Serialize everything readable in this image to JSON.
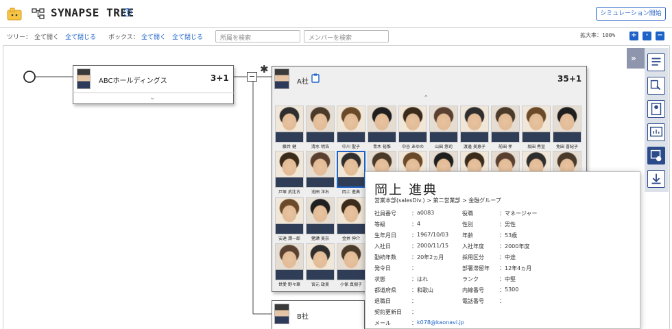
{
  "header": {
    "title": "SYNAPSE TREE",
    "help": "?",
    "simulation_button": "シミュレーション開始"
  },
  "toolbar": {
    "tree_label": "ツリー：",
    "tree_expand": "全て開く",
    "tree_collapse": "全て閉じる",
    "box_label": "ボックス：",
    "box_expand": "全て開く",
    "box_collapse": "全て閉じる",
    "search_dept_placeholder": "所属を検索",
    "search_member_placeholder": "メンバーを検索",
    "zoom_label": "拡大率：100%",
    "zoom_in": "+",
    "zoom_reset": "·",
    "zoom_out": "−"
  },
  "tree": {
    "root": {
      "name": "ABCホールディングス",
      "count": "3+1"
    },
    "company_a": {
      "name": "A社",
      "count": "35+1",
      "marker": "✱",
      "collapse": "−"
    },
    "company_b": {
      "name": "B社"
    }
  },
  "members": [
    "藤井 健",
    "清水 明浩",
    "中川 聖子",
    "青木 裕惟",
    "中谷 あゆの",
    "山田 悠司",
    "渡邊 美恵子",
    "前田 孝",
    "坂田 秀宣",
    "免田 喜紀子",
    "戸塚 武比古",
    "池田 洋右",
    "岡上 進典",
    "",
    "",
    "",
    "",
    "",
    "",
    "",
    "安達 潤一郎",
    "猪瀬 美奈",
    "金井 伸介",
    "世愛 野々華",
    "宮元 政美",
    "小保 真樹子"
  ],
  "selected_member": "岡上 進典",
  "popup": {
    "name": "岡上 進典",
    "path": "営業本部(salesDiv.) > 第二営業部 > 金融グループ",
    "left": [
      {
        "label": "社員番号",
        "value": "a0083"
      },
      {
        "label": "等級",
        "value": "4"
      },
      {
        "label": "生年月日",
        "value": "1967/10/03"
      },
      {
        "label": "入社日",
        "value": "2000/11/15"
      },
      {
        "label": "勤続年数",
        "value": "20年2ヵ月"
      },
      {
        "label": "発令日",
        "value": ""
      },
      {
        "label": "状態",
        "value": "はれ"
      },
      {
        "label": "都道府県",
        "value": "和歌山"
      },
      {
        "label": "退職日",
        "value": ""
      },
      {
        "label": "契約更新日",
        "value": ""
      },
      {
        "label": "メール",
        "value": "k078@kaonavi.jp"
      }
    ],
    "right": [
      {
        "label": "役職",
        "value": "マネージャー"
      },
      {
        "label": "性別",
        "value": "男性"
      },
      {
        "label": "年齢",
        "value": "53歳"
      },
      {
        "label": "入社年度",
        "value": "2000年度"
      },
      {
        "label": "採用区分",
        "value": "中途"
      },
      {
        "label": "部署滞留年",
        "value": "12年4ヵ月"
      },
      {
        "label": "ランク",
        "value": "中堅"
      },
      {
        "label": "内線番号",
        "value": "5300"
      },
      {
        "label": "電話番号",
        "value": ""
      }
    ]
  },
  "colors": {
    "accent": "#1d62c8",
    "side_dark": "#2c4b8a",
    "side_tab": "#8e96ad"
  }
}
